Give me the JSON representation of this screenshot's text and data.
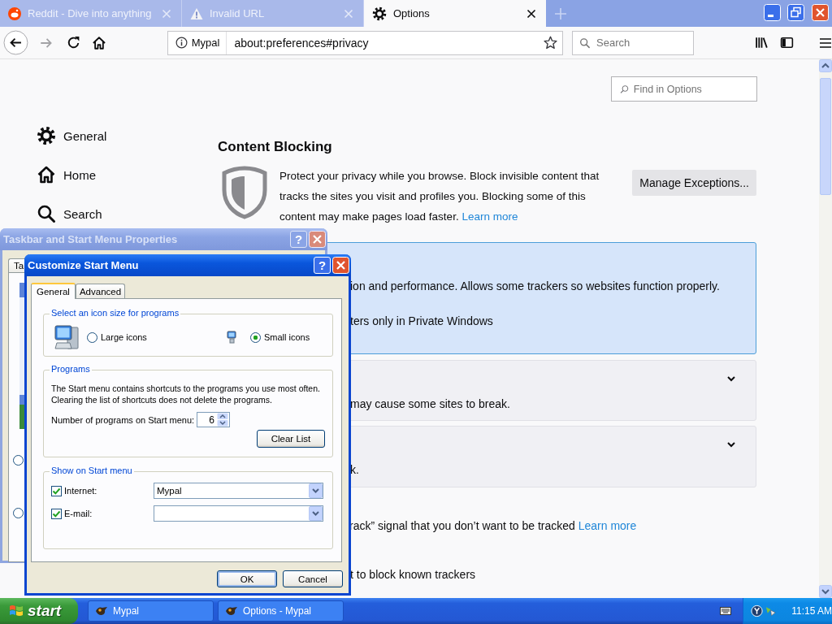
{
  "browser": {
    "tabs": [
      {
        "title": "Reddit - Dive into anything",
        "selected": false
      },
      {
        "title": "Invalid URL",
        "selected": false
      },
      {
        "title": "Options",
        "selected": true
      }
    ],
    "address_bar": {
      "site_label": "Mypal",
      "url": "about:preferences#privacy"
    },
    "search_field": {
      "placeholder": "Search"
    }
  },
  "preferences": {
    "find_field": {
      "placeholder": "Find in Options"
    },
    "categories": [
      {
        "label": "General"
      },
      {
        "label": "Home"
      },
      {
        "label": "Search"
      }
    ],
    "section_title": "Content Blocking",
    "intro": {
      "text": "Protect your privacy while you browse. Block invisible content that tracks the sites you visit and profiles you. Blocking some of this content may make pages load faster.",
      "link": "Learn more"
    },
    "manage_button": "Manage Exceptions...",
    "options": [
      {
        "selected": true,
        "lines": [
          "ion and performance. Allows some trackers so websites function properly.",
          "ters only in Private Windows"
        ]
      },
      {
        "selected": false,
        "lines": [
          "may cause some sites to break."
        ]
      },
      {
        "selected": false,
        "lines": [
          "k."
        ]
      }
    ],
    "dnt": {
      "text": "rack” signal that you don’t want to be tracked",
      "link": "Learn more"
    },
    "last_line": "t to block known trackers"
  },
  "back_dialog": {
    "title": "Taskbar and Start Menu Properties",
    "help": "?",
    "tab": "Ta",
    "radios": [
      {
        "selected": false
      },
      {
        "selected": false
      }
    ]
  },
  "dialog": {
    "title": "Customize Start Menu",
    "help": "?",
    "tabs": [
      {
        "label": "General",
        "selected": true
      },
      {
        "label": "Advanced",
        "selected": false
      }
    ],
    "icon_size": {
      "title": "Select an icon size for programs",
      "options": [
        {
          "label": "Large icons",
          "selected": false
        },
        {
          "label": "Small icons",
          "selected": true
        }
      ]
    },
    "programs": {
      "title": "Programs",
      "description": "The Start menu contains shortcuts to the programs you use most often.\nClearing the list of shortcuts does not delete the programs.",
      "count_label": "Number of programs on Start menu:",
      "count_value": "6",
      "clear_button": "Clear List"
    },
    "show_on_start": {
      "title": "Show on Start menu",
      "items": [
        {
          "label": "Internet:",
          "checked": true,
          "value": "Mypal"
        },
        {
          "label": "E-mail:",
          "checked": true
        }
      ]
    },
    "buttons": [
      {
        "label": "OK",
        "default": true
      },
      {
        "label": "Cancel",
        "default": false
      }
    ]
  },
  "taskbar": {
    "start": "start",
    "tasks": [
      {
        "label": "Mypal"
      },
      {
        "label": "Options - Mypal"
      }
    ],
    "clock": "11:15 AM"
  }
}
